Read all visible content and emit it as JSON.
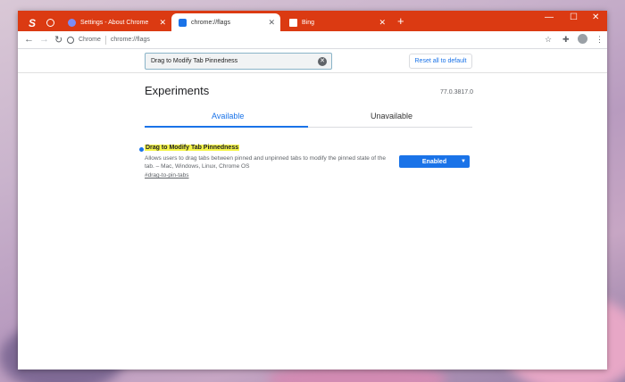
{
  "browser": {
    "pinned_tab_label": "S",
    "tabs": [
      {
        "title": "Settings - About Chrome",
        "favicon_color": "#4c6ef5"
      },
      {
        "title": "chrome://flags",
        "favicon_color": "#1a73e8"
      },
      {
        "title": "Bing",
        "favicon_color": "#008373"
      }
    ],
    "new_tab_icon": "+",
    "omnibox": {
      "site": "Chrome",
      "path": "chrome://flags"
    },
    "accent": "#db3a12"
  },
  "flags_page": {
    "search_value": "Drag to Modify Tab Pinnedness",
    "reset_label": "Reset all to default",
    "title": "Experiments",
    "version": "77.0.3817.0",
    "tabs": {
      "available": "Available",
      "unavailable": "Unavailable"
    },
    "flag": {
      "name": "Drag to Modify Tab Pinnedness",
      "description": "Allows users to drag tabs between pinned and unpinned tabs to modify the pinned state of the tab. – Mac, Windows, Linux, Chrome OS",
      "link": "#drag-to-pin-tabs",
      "state": "Enabled"
    }
  }
}
